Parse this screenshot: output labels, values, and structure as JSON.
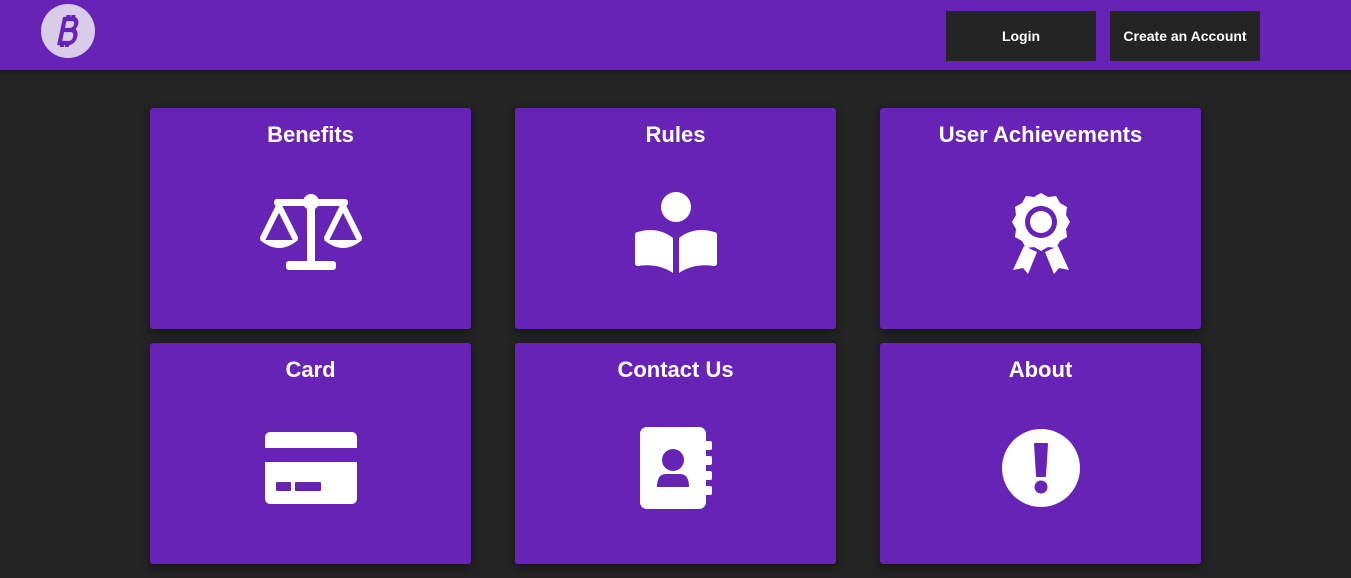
{
  "header": {
    "logo_icon": "bitcoin-icon",
    "login_label": "Login",
    "create_account_label": "Create an Account"
  },
  "cards": [
    {
      "title": "Benefits",
      "icon": "scale-balance-icon"
    },
    {
      "title": "Rules",
      "icon": "book-reader-icon"
    },
    {
      "title": "User Achievements",
      "icon": "award-ribbon-icon"
    },
    {
      "title": "Card",
      "icon": "credit-card-icon"
    },
    {
      "title": "Contact Us",
      "icon": "address-book-icon"
    },
    {
      "title": "About",
      "icon": "exclamation-circle-icon"
    }
  ],
  "colors": {
    "brand_purple": "#6723b6",
    "background": "#242424",
    "button_dark": "#242424",
    "icon_white": "#ffffff"
  }
}
